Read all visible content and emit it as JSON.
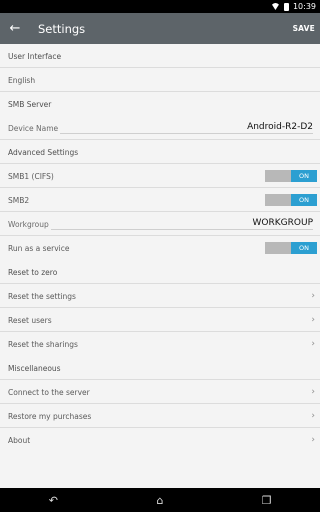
{
  "status_bar": {
    "time": "10:39"
  },
  "app_bar": {
    "title": "Settings",
    "save_label": "SAVE"
  },
  "sections": {
    "user_interface": {
      "header": "User Interface",
      "language": "English"
    },
    "smb_server": {
      "header": "SMB Server",
      "device_name_label": "Device Name",
      "device_name_value": "Android-R2-D2"
    },
    "advanced": {
      "header": "Advanced Settings",
      "smb1_label": "SMB1 (CIFS)",
      "smb1_state": "ON",
      "smb2_label": "SMB2",
      "smb2_state": "ON",
      "workgroup_label": "Workgroup",
      "workgroup_value": "WORKGROUP",
      "service_label": "Run as a service",
      "service_state": "ON"
    },
    "reset": {
      "header": "Reset to zero",
      "items": [
        "Reset the settings",
        "Reset users",
        "Reset the sharings"
      ]
    },
    "misc": {
      "header": "Miscellaneous",
      "items": [
        "Connect to the server",
        "Restore my purchases",
        "About"
      ]
    }
  },
  "icons": {
    "back": "arrow-left",
    "chevron": "chevron-right",
    "nav_back": "back",
    "nav_home": "home",
    "nav_recents": "recents"
  },
  "colors": {
    "toolbar": "#5d6469",
    "toggle_on": "#2c9fd1",
    "background": "#f4f4f4"
  }
}
